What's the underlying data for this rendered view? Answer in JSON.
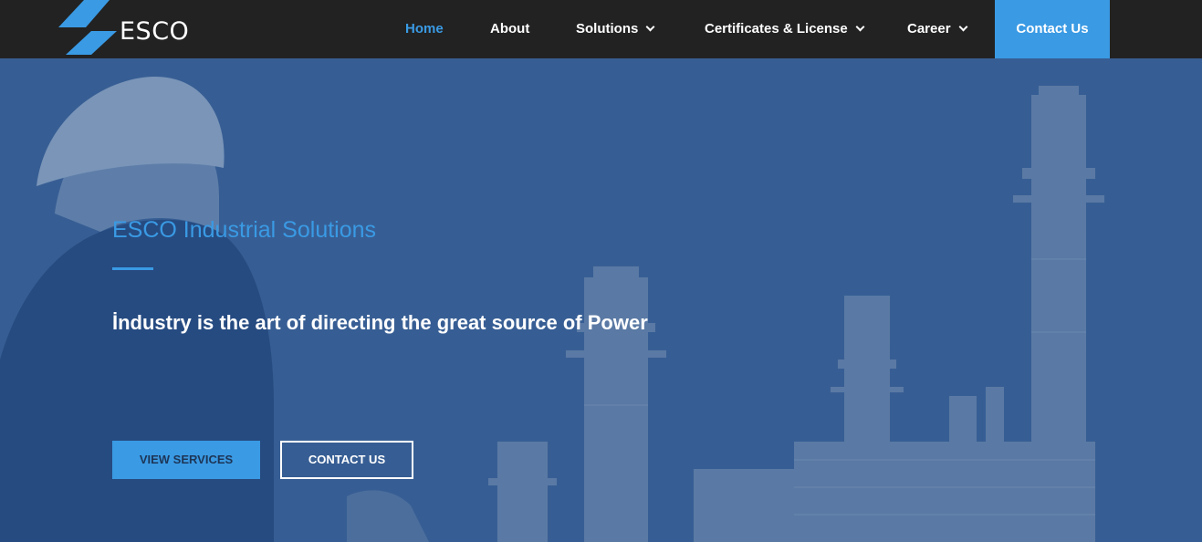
{
  "brand": {
    "name": "ESCO",
    "accent_color": "#3a9ae4",
    "header_bg": "#222222"
  },
  "nav": {
    "items": [
      {
        "label": "Home",
        "active": true,
        "has_dropdown": false
      },
      {
        "label": "About",
        "active": false,
        "has_dropdown": false
      },
      {
        "label": "Solutions",
        "active": false,
        "has_dropdown": true
      },
      {
        "label": "Certificates & License",
        "active": false,
        "has_dropdown": true
      },
      {
        "label": "Career",
        "active": false,
        "has_dropdown": true
      }
    ],
    "cta_label": "Contact Us"
  },
  "hero": {
    "subtitle": "ESCO Industrial Solutions",
    "title": "İndustry is the art of directing the great source of Power",
    "primary_button": "VIEW SERVICES",
    "secondary_button": "CONTACT US",
    "background": "worker-in-hard-hat-and-refinery-chimneys-image"
  }
}
